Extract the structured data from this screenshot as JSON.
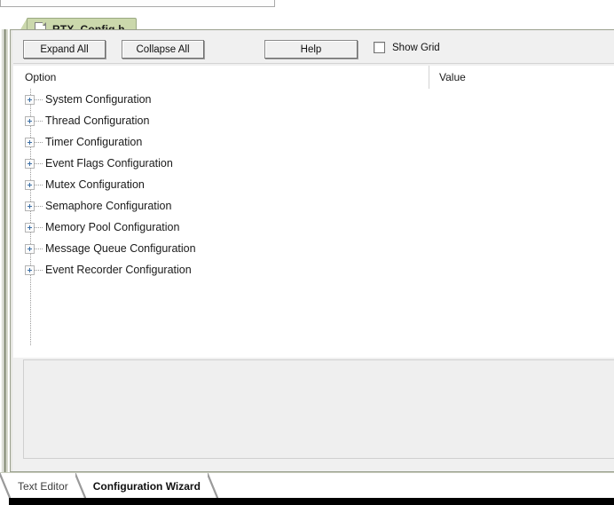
{
  "document_tab": {
    "label": "RTX_Config.h",
    "icon": "document-icon",
    "active": true,
    "background_color": "#cbd8ac"
  },
  "toolbar": {
    "expand_all_label": "Expand All",
    "collapse_all_label": "Collapse All",
    "help_label": "Help",
    "show_grid_label": "Show Grid",
    "show_grid_checked": false
  },
  "table": {
    "columns": [
      {
        "key": "option",
        "label": "Option"
      },
      {
        "key": "value",
        "label": "Value"
      }
    ],
    "rows": [
      {
        "label": "System Configuration",
        "value": "",
        "expanded": false,
        "expander_icon": "plus-box-icon"
      },
      {
        "label": "Thread Configuration",
        "value": "",
        "expanded": false,
        "expander_icon": "plus-box-icon"
      },
      {
        "label": "Timer Configuration",
        "value": "",
        "expanded": false,
        "expander_icon": "plus-box-icon"
      },
      {
        "label": "Event Flags Configuration",
        "value": "",
        "expanded": false,
        "expander_icon": "plus-box-icon"
      },
      {
        "label": "Mutex Configuration",
        "value": "",
        "expanded": false,
        "expander_icon": "plus-box-icon"
      },
      {
        "label": "Semaphore Configuration",
        "value": "",
        "expanded": false,
        "expander_icon": "plus-box-icon"
      },
      {
        "label": "Memory Pool Configuration",
        "value": "",
        "expanded": false,
        "expander_icon": "plus-box-icon"
      },
      {
        "label": "Message Queue Configuration",
        "value": "",
        "expanded": false,
        "expander_icon": "plus-box-icon"
      },
      {
        "label": "Event Recorder Configuration",
        "value": "",
        "expanded": false,
        "expander_icon": "plus-box-icon"
      }
    ]
  },
  "description_panel": {
    "text": ""
  },
  "view_tabs": {
    "items": [
      {
        "label": "Text Editor",
        "active": false
      },
      {
        "label": "Configuration Wizard",
        "active": true
      }
    ]
  }
}
